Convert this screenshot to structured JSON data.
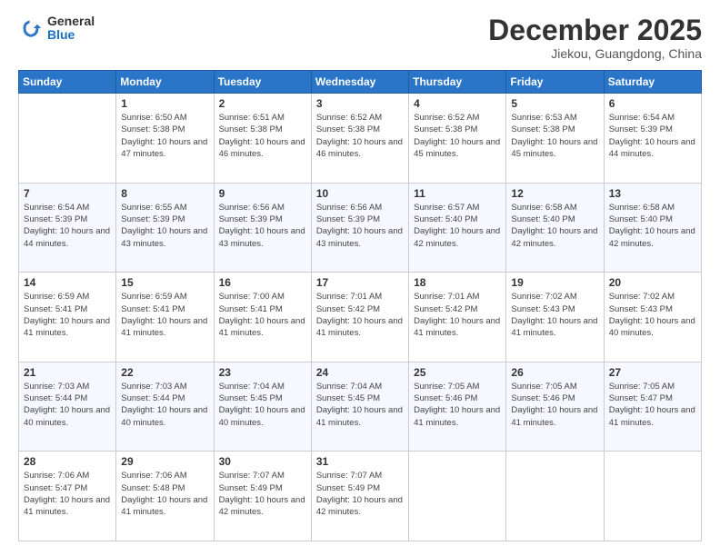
{
  "header": {
    "logo": {
      "line1": "General",
      "line2": "Blue"
    },
    "title": "December 2025",
    "location": "Jiekou, Guangdong, China"
  },
  "weekdays": [
    "Sunday",
    "Monday",
    "Tuesday",
    "Wednesday",
    "Thursday",
    "Friday",
    "Saturday"
  ],
  "weeks": [
    [
      null,
      {
        "day": 1,
        "sunrise": "6:50 AM",
        "sunset": "5:38 PM",
        "daylight": "10 hours and 47 minutes."
      },
      {
        "day": 2,
        "sunrise": "6:51 AM",
        "sunset": "5:38 PM",
        "daylight": "10 hours and 46 minutes."
      },
      {
        "day": 3,
        "sunrise": "6:52 AM",
        "sunset": "5:38 PM",
        "daylight": "10 hours and 46 minutes."
      },
      {
        "day": 4,
        "sunrise": "6:52 AM",
        "sunset": "5:38 PM",
        "daylight": "10 hours and 45 minutes."
      },
      {
        "day": 5,
        "sunrise": "6:53 AM",
        "sunset": "5:38 PM",
        "daylight": "10 hours and 45 minutes."
      },
      {
        "day": 6,
        "sunrise": "6:54 AM",
        "sunset": "5:39 PM",
        "daylight": "10 hours and 44 minutes."
      }
    ],
    [
      {
        "day": 7,
        "sunrise": "6:54 AM",
        "sunset": "5:39 PM",
        "daylight": "10 hours and 44 minutes."
      },
      {
        "day": 8,
        "sunrise": "6:55 AM",
        "sunset": "5:39 PM",
        "daylight": "10 hours and 43 minutes."
      },
      {
        "day": 9,
        "sunrise": "6:56 AM",
        "sunset": "5:39 PM",
        "daylight": "10 hours and 43 minutes."
      },
      {
        "day": 10,
        "sunrise": "6:56 AM",
        "sunset": "5:39 PM",
        "daylight": "10 hours and 43 minutes."
      },
      {
        "day": 11,
        "sunrise": "6:57 AM",
        "sunset": "5:40 PM",
        "daylight": "10 hours and 42 minutes."
      },
      {
        "day": 12,
        "sunrise": "6:58 AM",
        "sunset": "5:40 PM",
        "daylight": "10 hours and 42 minutes."
      },
      {
        "day": 13,
        "sunrise": "6:58 AM",
        "sunset": "5:40 PM",
        "daylight": "10 hours and 42 minutes."
      }
    ],
    [
      {
        "day": 14,
        "sunrise": "6:59 AM",
        "sunset": "5:41 PM",
        "daylight": "10 hours and 41 minutes."
      },
      {
        "day": 15,
        "sunrise": "6:59 AM",
        "sunset": "5:41 PM",
        "daylight": "10 hours and 41 minutes."
      },
      {
        "day": 16,
        "sunrise": "7:00 AM",
        "sunset": "5:41 PM",
        "daylight": "10 hours and 41 minutes."
      },
      {
        "day": 17,
        "sunrise": "7:01 AM",
        "sunset": "5:42 PM",
        "daylight": "10 hours and 41 minutes."
      },
      {
        "day": 18,
        "sunrise": "7:01 AM",
        "sunset": "5:42 PM",
        "daylight": "10 hours and 41 minutes."
      },
      {
        "day": 19,
        "sunrise": "7:02 AM",
        "sunset": "5:43 PM",
        "daylight": "10 hours and 41 minutes."
      },
      {
        "day": 20,
        "sunrise": "7:02 AM",
        "sunset": "5:43 PM",
        "daylight": "10 hours and 40 minutes."
      }
    ],
    [
      {
        "day": 21,
        "sunrise": "7:03 AM",
        "sunset": "5:44 PM",
        "daylight": "10 hours and 40 minutes."
      },
      {
        "day": 22,
        "sunrise": "7:03 AM",
        "sunset": "5:44 PM",
        "daylight": "10 hours and 40 minutes."
      },
      {
        "day": 23,
        "sunrise": "7:04 AM",
        "sunset": "5:45 PM",
        "daylight": "10 hours and 40 minutes."
      },
      {
        "day": 24,
        "sunrise": "7:04 AM",
        "sunset": "5:45 PM",
        "daylight": "10 hours and 41 minutes."
      },
      {
        "day": 25,
        "sunrise": "7:05 AM",
        "sunset": "5:46 PM",
        "daylight": "10 hours and 41 minutes."
      },
      {
        "day": 26,
        "sunrise": "7:05 AM",
        "sunset": "5:46 PM",
        "daylight": "10 hours and 41 minutes."
      },
      {
        "day": 27,
        "sunrise": "7:05 AM",
        "sunset": "5:47 PM",
        "daylight": "10 hours and 41 minutes."
      }
    ],
    [
      {
        "day": 28,
        "sunrise": "7:06 AM",
        "sunset": "5:47 PM",
        "daylight": "10 hours and 41 minutes."
      },
      {
        "day": 29,
        "sunrise": "7:06 AM",
        "sunset": "5:48 PM",
        "daylight": "10 hours and 41 minutes."
      },
      {
        "day": 30,
        "sunrise": "7:07 AM",
        "sunset": "5:49 PM",
        "daylight": "10 hours and 42 minutes."
      },
      {
        "day": 31,
        "sunrise": "7:07 AM",
        "sunset": "5:49 PM",
        "daylight": "10 hours and 42 minutes."
      },
      null,
      null,
      null
    ]
  ]
}
